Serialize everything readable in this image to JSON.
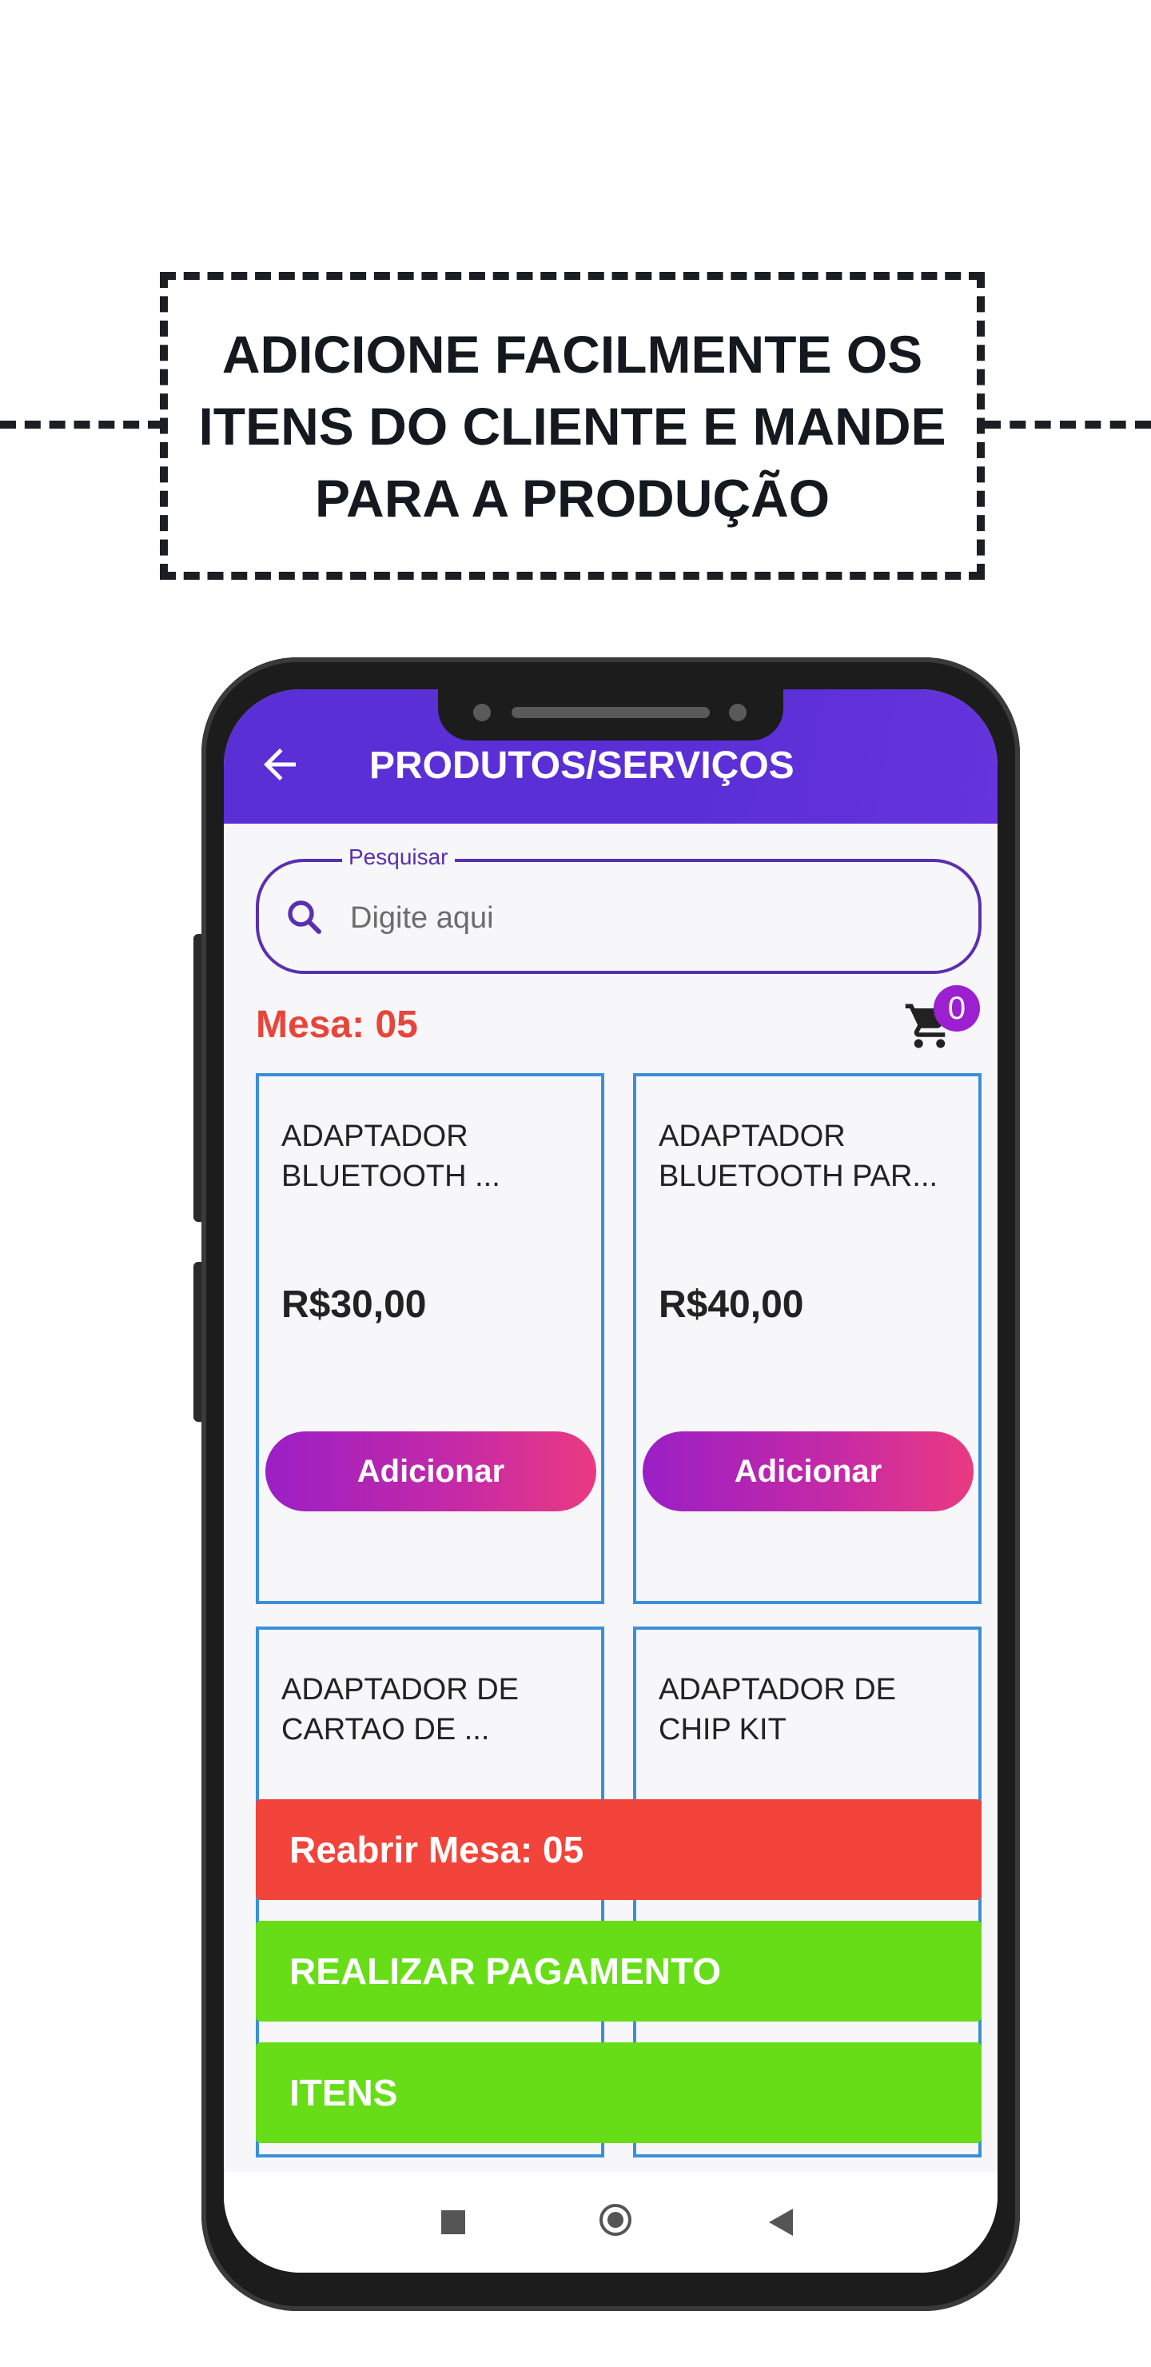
{
  "headline": {
    "line1": "ADICIONE FACILMENTE OS",
    "line2": "ITENS DO CLIENTE E MANDE",
    "line3": "PARA A PRODUÇÃO"
  },
  "appbar": {
    "title": "PRODUTOS/SERVIÇOS",
    "back_icon": "arrow-left-icon"
  },
  "search": {
    "label": "Pesquisar",
    "placeholder": "Digite aqui",
    "value": "",
    "icon": "search-icon"
  },
  "table": {
    "label": "Mesa: 05"
  },
  "cart": {
    "icon": "cart-icon",
    "count": "0"
  },
  "products": [
    {
      "name": "ADAPTADOR\nBLUETOOTH ...",
      "price": "R$30,00",
      "button": "Adicionar"
    },
    {
      "name": "ADAPTADOR\nBLUETOOTH PAR...",
      "price": "R$40,00",
      "button": "Adicionar"
    },
    {
      "name": "ADAPTADOR DE\nCARTAO DE ...",
      "price": "",
      "button": ""
    },
    {
      "name": "ADAPTADOR DE\nCHIP KIT",
      "price": "",
      "button": ""
    }
  ],
  "actions": {
    "reopen": "Reabrir Mesa: 05",
    "pay": "REALIZAR PAGAMENTO",
    "items": "ITENS"
  },
  "colors": {
    "appbar": "#5a2fd6",
    "mesa": "#e8453a",
    "reopen": "#f2443a",
    "green": "#66dd17",
    "badge": "#9c1fd1",
    "card_border": "#3b8fd8"
  }
}
